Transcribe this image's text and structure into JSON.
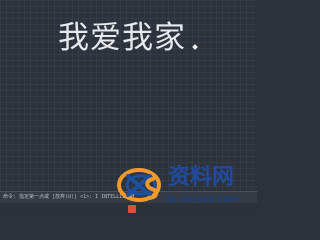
{
  "canvas": {
    "text": "我爱我家"
  },
  "command_line": {
    "text": "命令: 指定第一点或 [放弃(U)] <1>: I INTELLIZOOM"
  },
  "watermark": {
    "logo_text": "资料网",
    "domain": "ZL.XS1616.COM"
  },
  "colors": {
    "background": "#2b323c",
    "grid": "#333b46",
    "text": "#e7e9ec",
    "watermark_blue": "#214a9c",
    "watermark_orange": "#f09a2d"
  },
  "icons": {
    "cursor": "crosshair-cursor-icon",
    "logo": "xs-logo-icon"
  }
}
